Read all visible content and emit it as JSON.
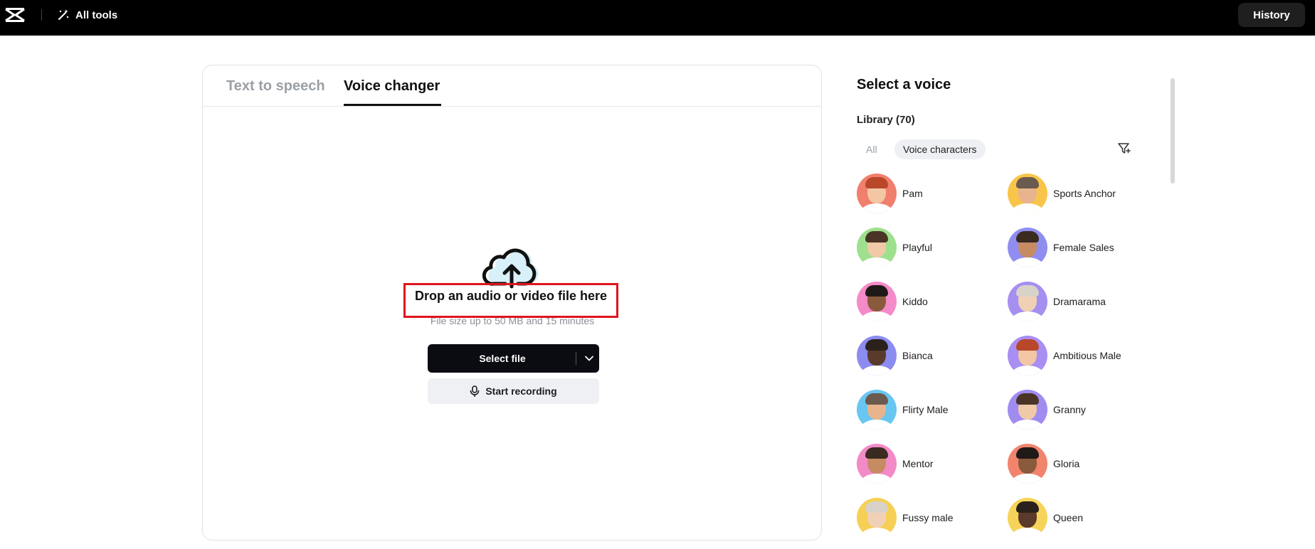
{
  "topbar": {
    "logo_icon": "capcut-logo-icon",
    "all_tools_label": "All tools",
    "all_tools_icon": "magic-wand-icon",
    "history_label": "History"
  },
  "tabs": [
    {
      "label": "Text to speech",
      "active": false
    },
    {
      "label": "Voice changer",
      "active": true
    }
  ],
  "upload": {
    "icon": "cloud-upload-icon",
    "title": "Drop an audio or video file here",
    "subtitle": "File size up to 50 MB and 15 minutes",
    "select_file_label": "Select file",
    "dropdown_icon": "chevron-down-icon",
    "start_recording_label": "Start recording",
    "microphone_icon": "microphone-icon"
  },
  "voice_panel": {
    "title": "Select a voice",
    "library_label": "Library (70)",
    "filters": [
      {
        "label": "All",
        "active": false
      },
      {
        "label": "Voice characters",
        "active": true
      }
    ],
    "filter_icon": "filter-icon",
    "voices": [
      {
        "name": "Pam",
        "bg": "#f17f6d"
      },
      {
        "name": "Sports Anchor",
        "bg": "#f8c54a"
      },
      {
        "name": "Playful",
        "bg": "#9ee08e"
      },
      {
        "name": "Female Sales",
        "bg": "#8f8ef0"
      },
      {
        "name": "Kiddo",
        "bg": "#f58ac9"
      },
      {
        "name": "Dramarama",
        "bg": "#a58ff1"
      },
      {
        "name": "Bianca",
        "bg": "#8b8bf0"
      },
      {
        "name": "Ambitious Male",
        "bg": "#a98ef3"
      },
      {
        "name": "Flirty Male",
        "bg": "#69c6f0"
      },
      {
        "name": "Granny",
        "bg": "#a08cf0"
      },
      {
        "name": "Mentor",
        "bg": "#f38ac8"
      },
      {
        "name": "Gloria",
        "bg": "#f2846e"
      },
      {
        "name": "Fussy male",
        "bg": "#f6cf55"
      },
      {
        "name": "Queen",
        "bg": "#f6d45a"
      }
    ]
  }
}
